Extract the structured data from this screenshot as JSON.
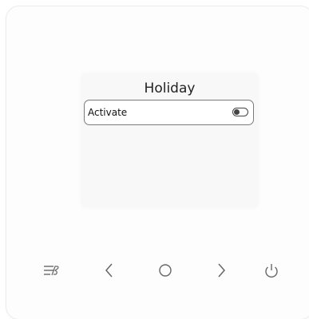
{
  "screen": {
    "title": "Holiday",
    "rows": [
      {
        "label": "Activate",
        "toggle_on": false
      }
    ]
  },
  "buttons": {
    "menu": "menu-icon",
    "back": "chevron-left-icon",
    "select": "circle-icon",
    "next": "chevron-right-icon",
    "power": "power-icon"
  }
}
